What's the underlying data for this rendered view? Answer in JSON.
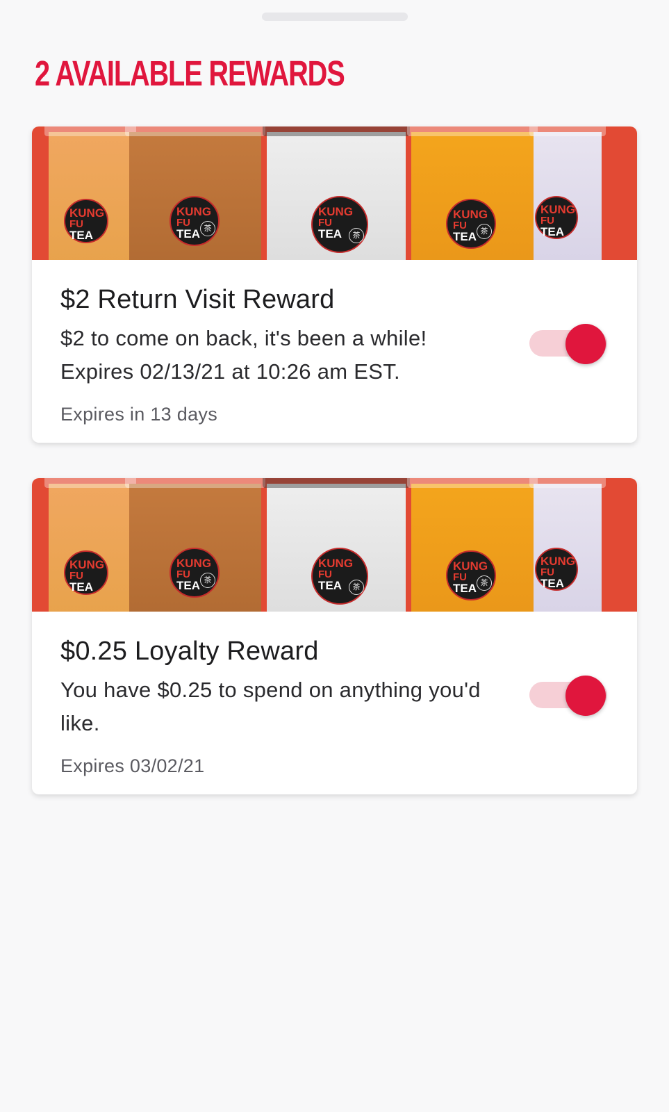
{
  "header": {
    "title": "2 AVAILABLE REWARDS"
  },
  "colors": {
    "accent": "#e0163d",
    "toggle_track": "#f6cfd6",
    "banner_bg": "#e24a34"
  },
  "banner": {
    "logo_line1": "KUNG",
    "logo_line2": "FU",
    "logo_line3": "TEA",
    "logo_cn": "茶"
  },
  "rewards": [
    {
      "title": "$2 Return Visit Reward",
      "description": "$2 to come on back, it's been a while! Expires 02/13/21 at 10:26 am EST.",
      "expiry": "Expires in 13 days",
      "toggle_on": true
    },
    {
      "title": "$0.25 Loyalty Reward",
      "description": "You have $0.25 to spend on anything you'd like.",
      "expiry": "Expires 03/02/21",
      "toggle_on": true
    }
  ]
}
